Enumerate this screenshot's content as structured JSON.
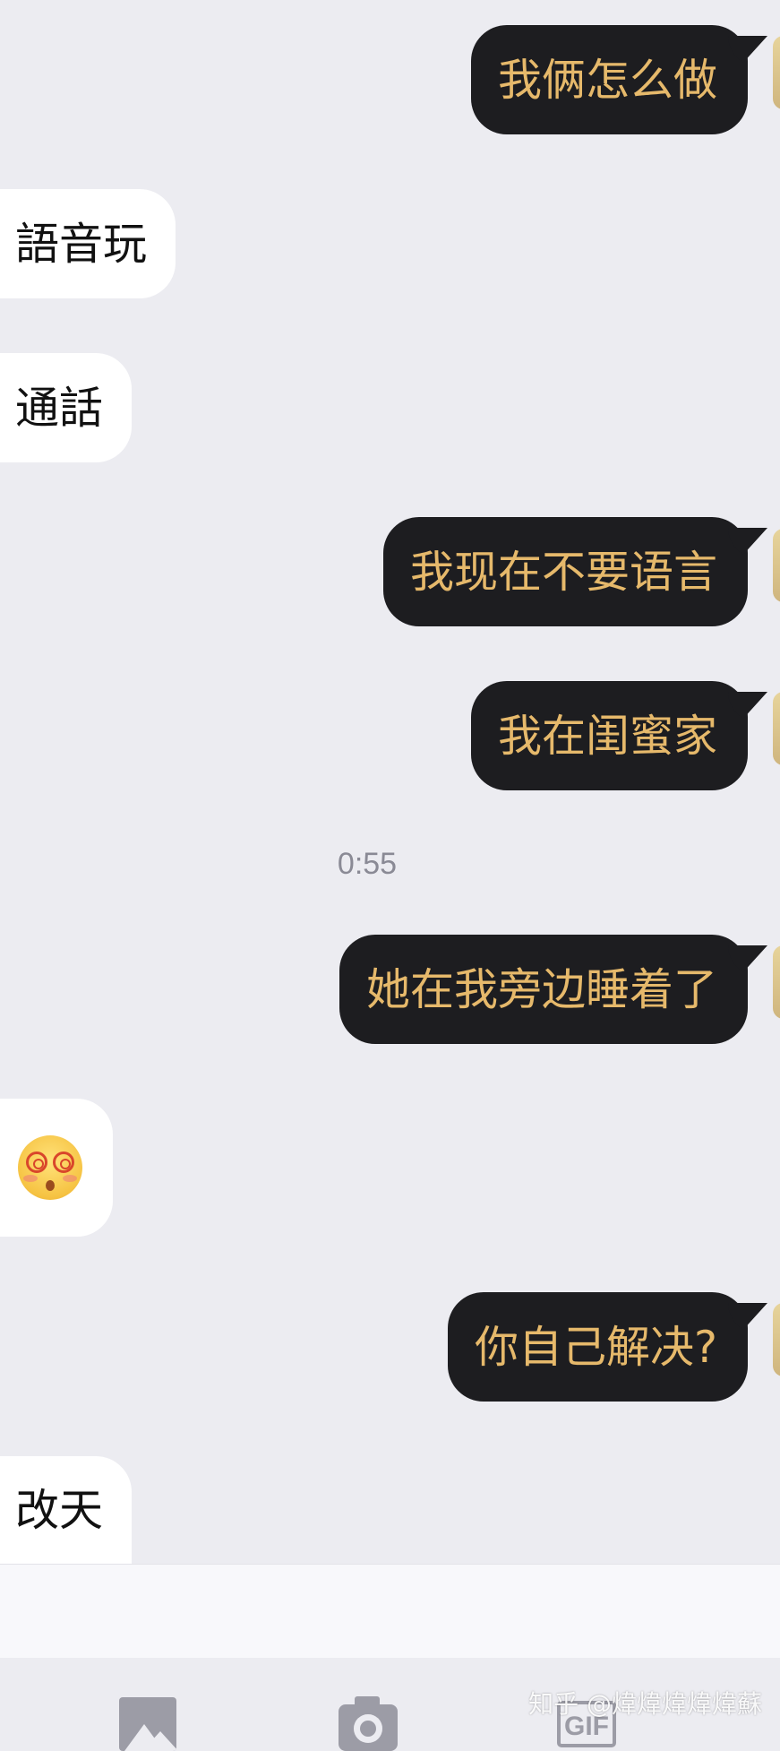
{
  "messages": [
    {
      "direction": "out",
      "text": "我俩怎么做"
    },
    {
      "direction": "in",
      "text": "語音玩"
    },
    {
      "direction": "in",
      "text": "通話"
    },
    {
      "direction": "out",
      "text": "我现在不要语言"
    },
    {
      "direction": "out",
      "text": "我在闺蜜家"
    },
    {
      "direction": "timestamp",
      "text": "0:55"
    },
    {
      "direction": "out",
      "text": "她在我旁边睡着了"
    },
    {
      "direction": "in",
      "emoji": "dizzy-face-emoji"
    },
    {
      "direction": "out",
      "text": "你自己解决?"
    },
    {
      "direction": "in",
      "text": "改天"
    }
  ],
  "toolbar": {
    "icons": [
      "image-icon",
      "camera-icon",
      "gif-icon"
    ],
    "gif_label": "GIF"
  },
  "watermark": "知乎 @煒煒煒煒煒蘇",
  "colors": {
    "chat_background": "#ECECF1",
    "outgoing_bubble": "#1D1D20",
    "outgoing_text": "#E6B96B",
    "incoming_bubble": "#FFFFFF",
    "incoming_text": "#111111",
    "timestamp_text": "#8A8A95"
  }
}
